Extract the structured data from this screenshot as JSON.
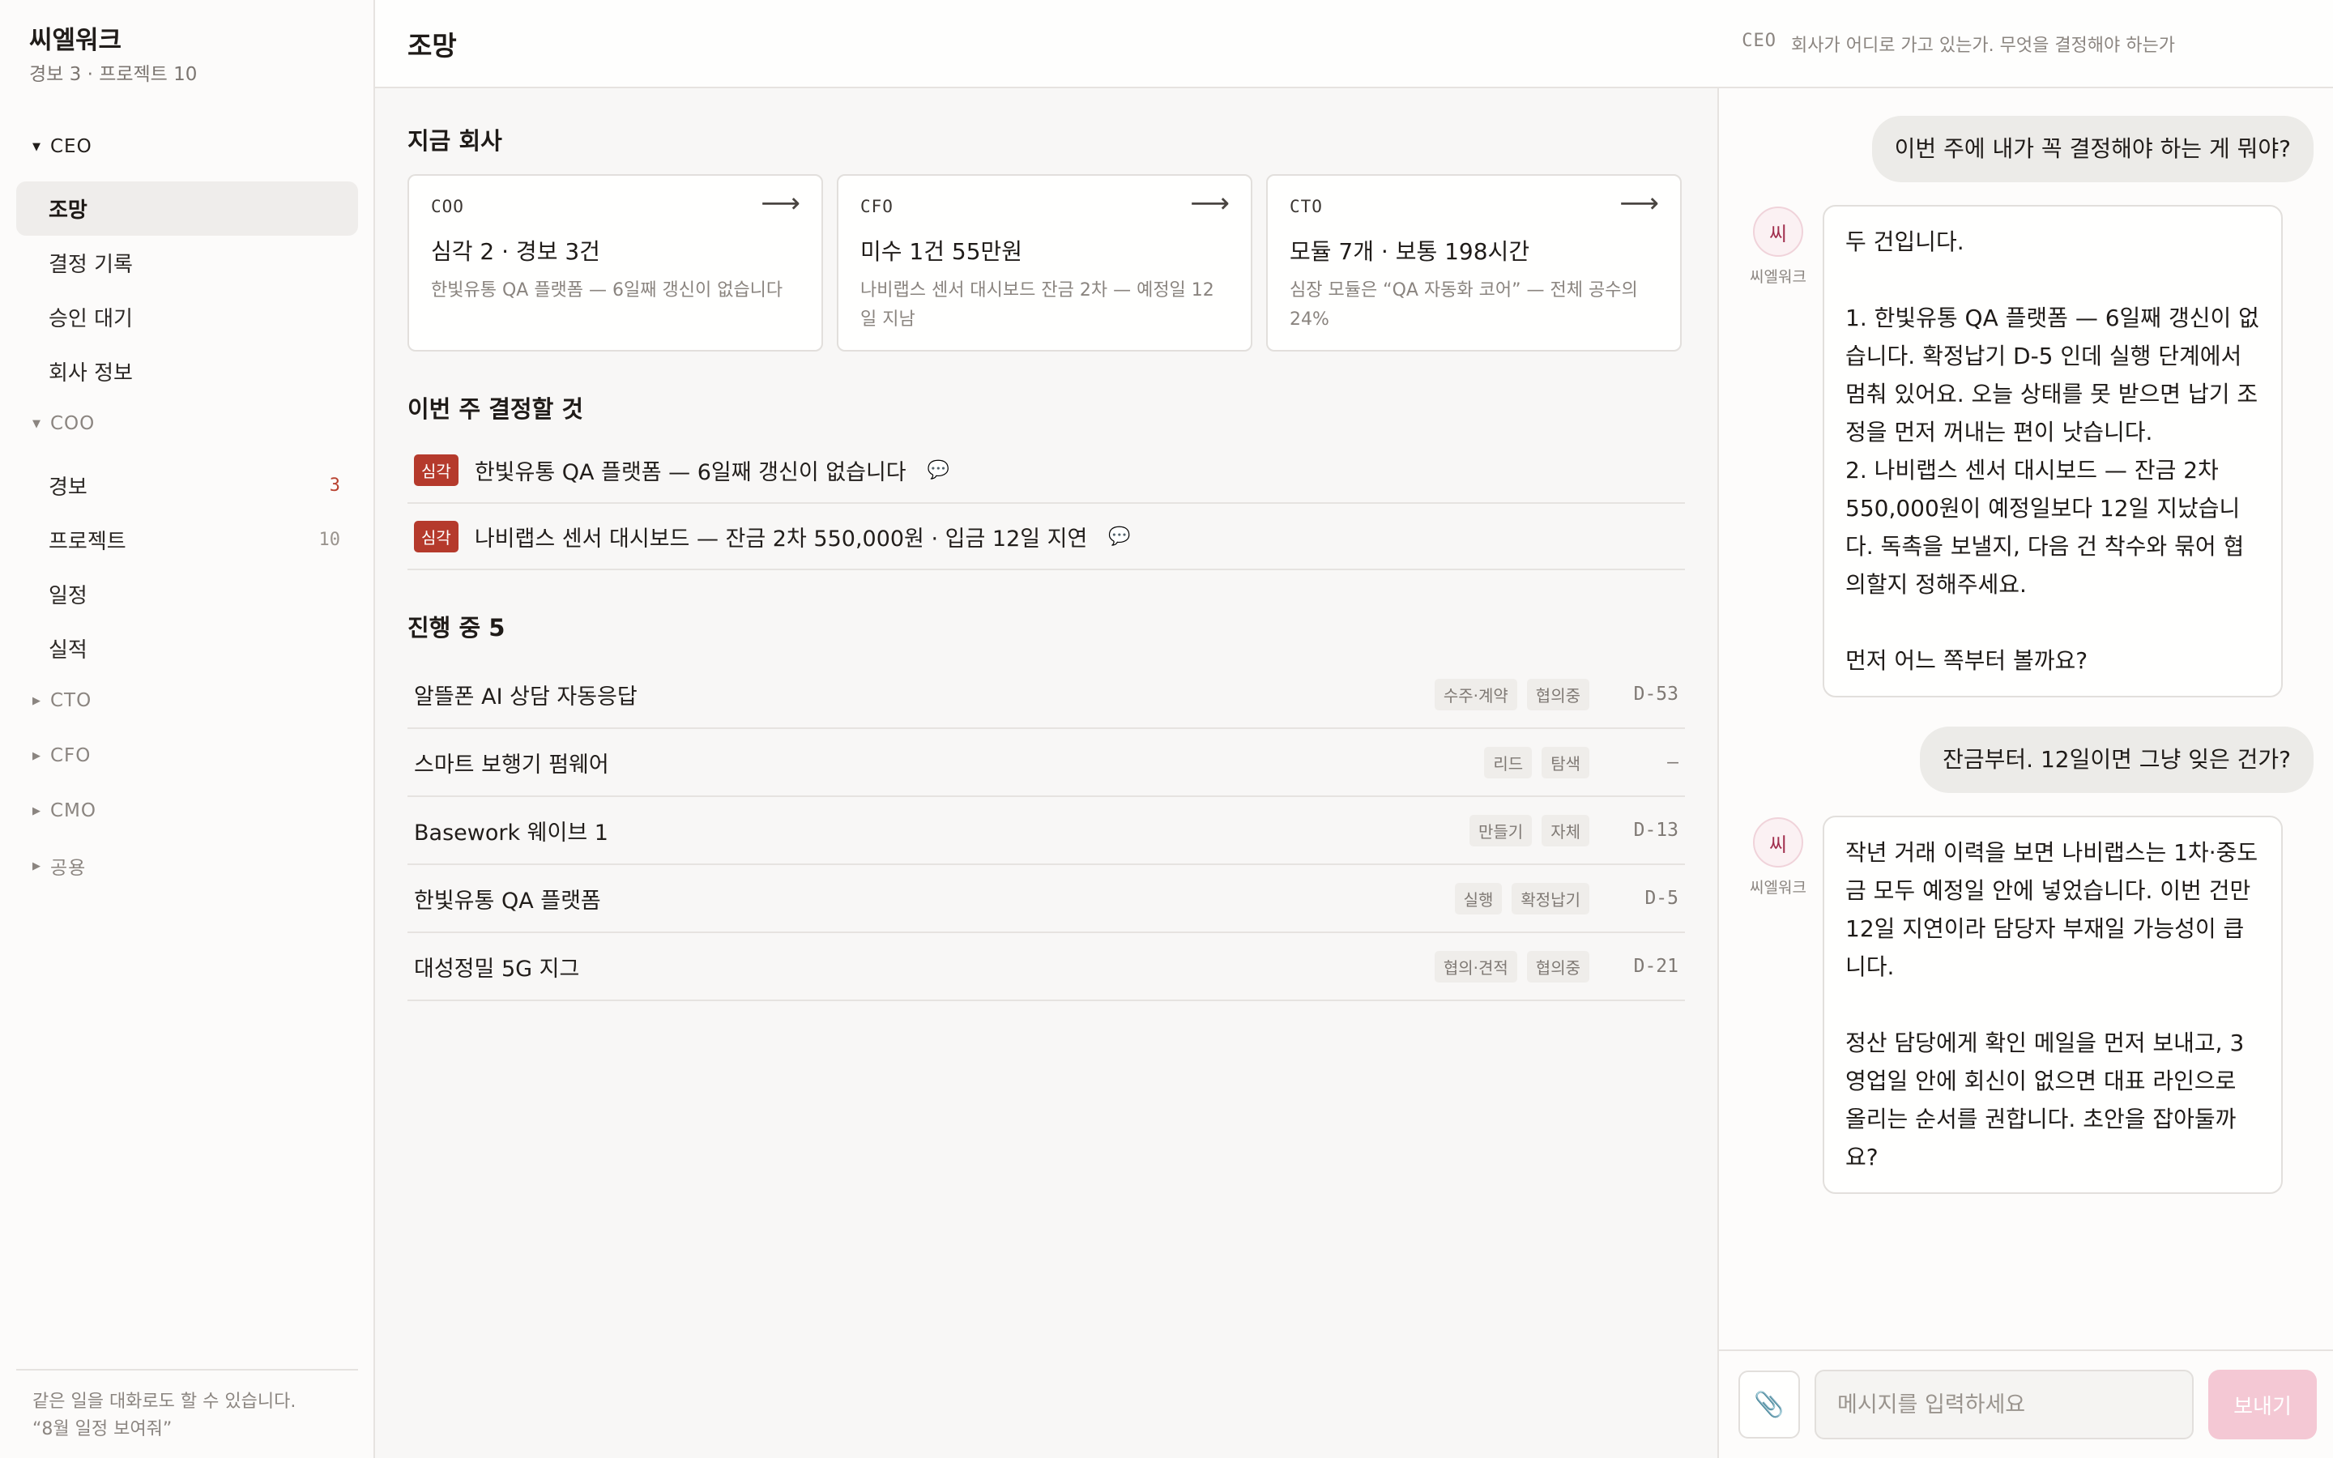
{
  "sidebar": {
    "brand": "씨엘워크",
    "summary": "경보 3 · 프로젝트 10",
    "groups": [
      {
        "label": "CEO",
        "items": [
          {
            "label": "조망"
          },
          {
            "label": "결정 기록"
          },
          {
            "label": "승인 대기"
          },
          {
            "label": "회사 정보"
          }
        ]
      },
      {
        "label": "COO",
        "items": [
          {
            "label": "경보",
            "count": "3"
          },
          {
            "label": "프로젝트",
            "count": "10"
          },
          {
            "label": "일정"
          },
          {
            "label": "실적"
          }
        ]
      },
      {
        "label": "CTO"
      },
      {
        "label": "CFO"
      },
      {
        "label": "CMO"
      },
      {
        "label": "공용"
      }
    ],
    "footer_line1": "같은 일을 대화로도 할 수 있습니다.",
    "footer_line2": "“8월 일정 보여줘”"
  },
  "header": {
    "title": "조망",
    "role": "CEO",
    "subtitle": "회사가 어디로 가고 있는가. 무엇을 결정해야 하는가"
  },
  "overview": {
    "title": "지금 회사",
    "cards": [
      {
        "role": "COO",
        "headline": "심각 2 · 경보 3건",
        "desc": "한빛유통 QA 플랫폼 — 6일째 갱신이 없습니다"
      },
      {
        "role": "CFO",
        "headline": "미수 1건 55만원",
        "desc": "나비랩스 센서 대시보드 잔금 2차 — 예정일 12일 지남"
      },
      {
        "role": "CTO",
        "headline": "모듈 7개 · 보통 198시간",
        "desc": "심장 모듈은 “QA 자동화 코어” — 전체 공수의 24%"
      }
    ]
  },
  "decisions": {
    "title": "이번 주 결정할 것",
    "items": [
      {
        "badge": "심각",
        "text": "한빛유통 QA 플랫폼 — 6일째 갱신이 없습니다"
      },
      {
        "badge": "심각",
        "text": "나비랩스 센서 대시보드 — 잔금 2차 550,000원 · 입금 12일 지연"
      }
    ]
  },
  "projects": {
    "title": "진행 중 5",
    "rows": [
      {
        "name": "알뜰폰 AI 상담 자동응답",
        "tag1": "수주·계약",
        "tag2": "협의중",
        "due": "D-53"
      },
      {
        "name": "스마트 보행기 펌웨어",
        "tag1": "리드",
        "tag2": "탐색",
        "due": "–"
      },
      {
        "name": "Basework 웨이브 1",
        "tag1": "만들기",
        "tag2": "자체",
        "due": "D-13"
      },
      {
        "name": "한빛유통 QA 플랫폼",
        "tag1": "실행",
        "tag2": "확정납기",
        "due": "D-5"
      },
      {
        "name": "대성정밀 5G 지그",
        "tag1": "협의·견적",
        "tag2": "협의중",
        "due": "D-21"
      }
    ]
  },
  "chat": {
    "bot_avatar": "씨",
    "bot_name": "씨엘워크",
    "messages": [
      {
        "text": "이번 주에 내가 꼭 결정해야 하는 게 뭐야?"
      },
      {
        "text": "두 건입니다.\n\n1. 한빛유통 QA 플랫폼 — 6일째 갱신이 없습니다. 확정납기 D-5 인데 실행 단계에서 멈춰 있어요. 오늘 상태를 못 받으면 납기 조정을 먼저 꺼내는 편이 낫습니다.\n2. 나비랩스 센서 대시보드 — 잔금 2차 550,000원이 예정일보다 12일 지났습니다. 독촉을 보낼지, 다음 건 착수와 묶어 협의할지 정해주세요.\n\n먼저 어느 쪽부터 볼까요?"
      },
      {
        "text": "잔금부터. 12일이면 그냥 잊은 건가?"
      },
      {
        "text": "작년 거래 이력을 보면 나비랩스는 1차·중도금 모두 예정일 안에 넣었습니다. 이번 건만 12일 지연이라 담당자 부재일 가능성이 큽니다.\n\n정산 담당에게 확인 메일을 먼저 보내고, 3영업일 안에 회신이 없으면 대표 라인으로 올리는 순서를 권합니다. 초안을 잡아둘까요?"
      }
    ],
    "input_placeholder": "메시지를 입력하세요",
    "send_label": "보내기"
  }
}
